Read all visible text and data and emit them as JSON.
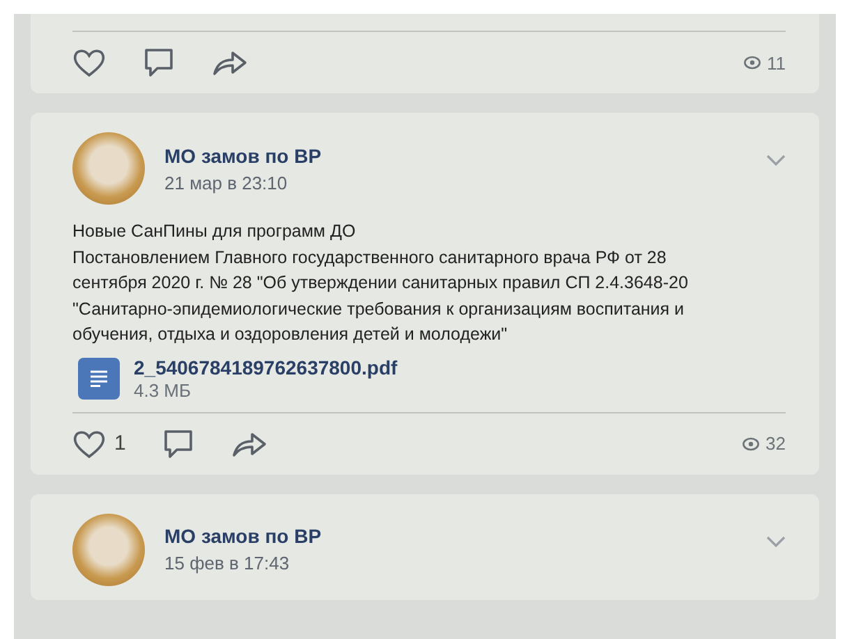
{
  "posts": [
    {
      "footer": {
        "views": "11"
      }
    },
    {
      "author": "МО замов по ВР",
      "date": "21 мар в 23:10",
      "text": [
        "Новые СанПины для программ ДО",
        "Постановлением Главного государственного санитарного врача РФ от 28 сентября 2020 г. № 28 \"Об утверждении санитарных правил СП 2.4.3648-20 \"Санитарно-эпидемиологические требования к организациям воспитания и обучения, отдыха и оздоровления детей и молодежи\""
      ],
      "attachment": {
        "name": "2_5406784189762637800.pdf",
        "size": "4.3 МБ"
      },
      "footer": {
        "likes": "1",
        "views": "32"
      }
    },
    {
      "author": "МО замов по ВР",
      "date": "15 фев в 17:43"
    }
  ]
}
